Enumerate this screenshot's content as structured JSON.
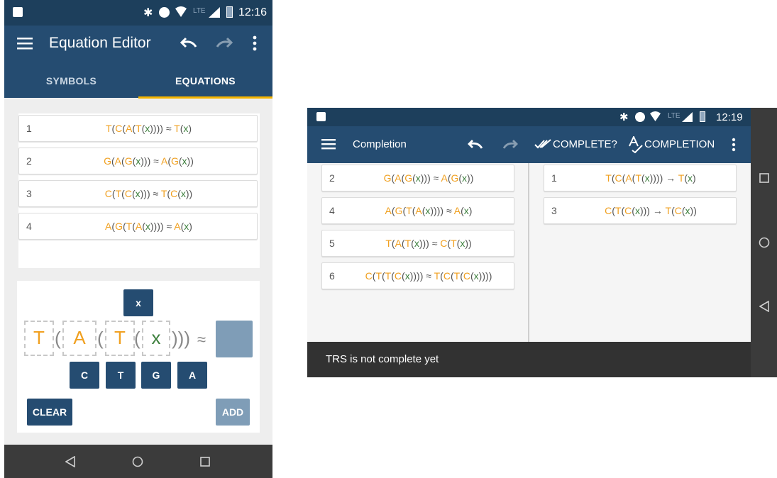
{
  "left_screen": {
    "status_bar": {
      "time": "12:16",
      "network": "LTE"
    },
    "app_bar": {
      "title": "Equation Editor"
    },
    "tabs": [
      {
        "label": "SYMBOLS"
      },
      {
        "label": "EQUATIONS",
        "selected": true
      }
    ],
    "equations": [
      {
        "num": "1",
        "expr": "T(C(A(T(x)))) ≈ T(x)"
      },
      {
        "num": "2",
        "expr": "G(A(G(x))) ≈ A(G(x))"
      },
      {
        "num": "3",
        "expr": "C(T(C(x))) ≈ T(C(x))"
      },
      {
        "num": "4",
        "expr": "A(G(T(A(x)))) ≈ A(x)"
      }
    ],
    "builder": {
      "variable_button": "x",
      "slots": [
        "T",
        "A",
        "T",
        "x"
      ],
      "parens_open": "(",
      "closing": ")))",
      "approx": "≈",
      "symbol_buttons": [
        "C",
        "T",
        "G",
        "A"
      ],
      "clear_label": "CLEAR",
      "add_label": "ADD"
    }
  },
  "right_screen": {
    "status_bar": {
      "time": "12:19",
      "network": "LTE"
    },
    "app_bar": {
      "title": "Completion",
      "complete_check_label": "COMPLETE?",
      "completion_label": "COMPLETION"
    },
    "equations": [
      {
        "num": "2",
        "expr": "G(A(G(x))) ≈ A(G(x))"
      },
      {
        "num": "4",
        "expr": "A(G(T(A(x)))) ≈ A(x)"
      },
      {
        "num": "5",
        "expr": "T(A(T(x))) ≈ C(T(x))"
      },
      {
        "num": "6",
        "expr": "C(T(T(C(x)))) ≈ T(C(T(C(x))))"
      }
    ],
    "rules": [
      {
        "num": "1",
        "expr": "T(C(A(T(x)))) → T(x)"
      },
      {
        "num": "3",
        "expr": "C(T(C(x))) → T(C(x))"
      }
    ],
    "snackbar": "TRS is not complete yet"
  },
  "colors": {
    "appbar": "#254c71",
    "statusbar": "#1d3f5c",
    "tab_indicator": "#f4b400",
    "symbol_orange": "#f0a020",
    "variable_green": "#3c7f3c"
  }
}
